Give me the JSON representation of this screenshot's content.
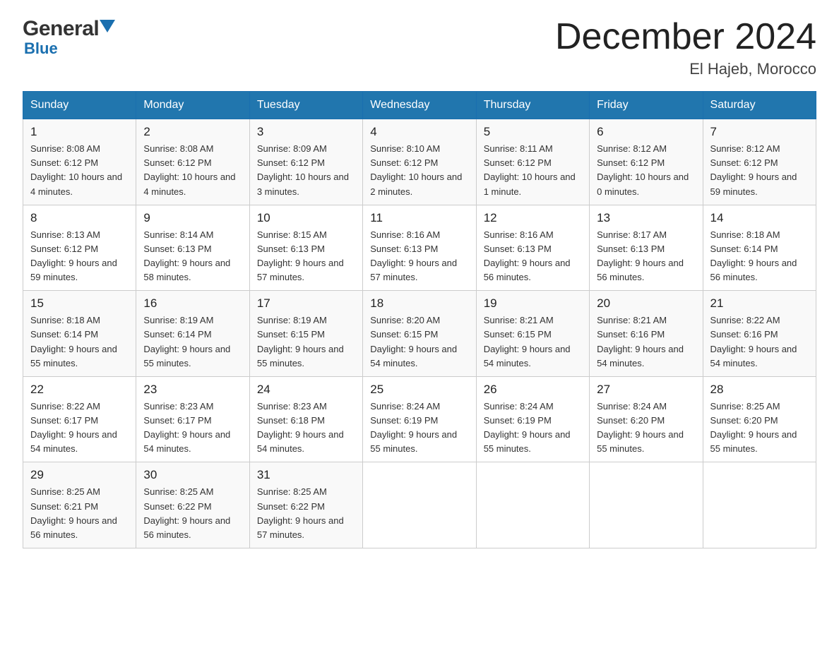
{
  "header": {
    "logo_general": "General",
    "logo_blue": "Blue",
    "main_title": "December 2024",
    "subtitle": "El Hajeb, Morocco"
  },
  "weekdays": [
    "Sunday",
    "Monday",
    "Tuesday",
    "Wednesday",
    "Thursday",
    "Friday",
    "Saturday"
  ],
  "weeks": [
    [
      {
        "day": 1,
        "sunrise": "8:08 AM",
        "sunset": "6:12 PM",
        "daylight": "10 hours and 4 minutes."
      },
      {
        "day": 2,
        "sunrise": "8:08 AM",
        "sunset": "6:12 PM",
        "daylight": "10 hours and 4 minutes."
      },
      {
        "day": 3,
        "sunrise": "8:09 AM",
        "sunset": "6:12 PM",
        "daylight": "10 hours and 3 minutes."
      },
      {
        "day": 4,
        "sunrise": "8:10 AM",
        "sunset": "6:12 PM",
        "daylight": "10 hours and 2 minutes."
      },
      {
        "day": 5,
        "sunrise": "8:11 AM",
        "sunset": "6:12 PM",
        "daylight": "10 hours and 1 minute."
      },
      {
        "day": 6,
        "sunrise": "8:12 AM",
        "sunset": "6:12 PM",
        "daylight": "10 hours and 0 minutes."
      },
      {
        "day": 7,
        "sunrise": "8:12 AM",
        "sunset": "6:12 PM",
        "daylight": "9 hours and 59 minutes."
      }
    ],
    [
      {
        "day": 8,
        "sunrise": "8:13 AM",
        "sunset": "6:12 PM",
        "daylight": "9 hours and 59 minutes."
      },
      {
        "day": 9,
        "sunrise": "8:14 AM",
        "sunset": "6:13 PM",
        "daylight": "9 hours and 58 minutes."
      },
      {
        "day": 10,
        "sunrise": "8:15 AM",
        "sunset": "6:13 PM",
        "daylight": "9 hours and 57 minutes."
      },
      {
        "day": 11,
        "sunrise": "8:16 AM",
        "sunset": "6:13 PM",
        "daylight": "9 hours and 57 minutes."
      },
      {
        "day": 12,
        "sunrise": "8:16 AM",
        "sunset": "6:13 PM",
        "daylight": "9 hours and 56 minutes."
      },
      {
        "day": 13,
        "sunrise": "8:17 AM",
        "sunset": "6:13 PM",
        "daylight": "9 hours and 56 minutes."
      },
      {
        "day": 14,
        "sunrise": "8:18 AM",
        "sunset": "6:14 PM",
        "daylight": "9 hours and 56 minutes."
      }
    ],
    [
      {
        "day": 15,
        "sunrise": "8:18 AM",
        "sunset": "6:14 PM",
        "daylight": "9 hours and 55 minutes."
      },
      {
        "day": 16,
        "sunrise": "8:19 AM",
        "sunset": "6:14 PM",
        "daylight": "9 hours and 55 minutes."
      },
      {
        "day": 17,
        "sunrise": "8:19 AM",
        "sunset": "6:15 PM",
        "daylight": "9 hours and 55 minutes."
      },
      {
        "day": 18,
        "sunrise": "8:20 AM",
        "sunset": "6:15 PM",
        "daylight": "9 hours and 54 minutes."
      },
      {
        "day": 19,
        "sunrise": "8:21 AM",
        "sunset": "6:15 PM",
        "daylight": "9 hours and 54 minutes."
      },
      {
        "day": 20,
        "sunrise": "8:21 AM",
        "sunset": "6:16 PM",
        "daylight": "9 hours and 54 minutes."
      },
      {
        "day": 21,
        "sunrise": "8:22 AM",
        "sunset": "6:16 PM",
        "daylight": "9 hours and 54 minutes."
      }
    ],
    [
      {
        "day": 22,
        "sunrise": "8:22 AM",
        "sunset": "6:17 PM",
        "daylight": "9 hours and 54 minutes."
      },
      {
        "day": 23,
        "sunrise": "8:23 AM",
        "sunset": "6:17 PM",
        "daylight": "9 hours and 54 minutes."
      },
      {
        "day": 24,
        "sunrise": "8:23 AM",
        "sunset": "6:18 PM",
        "daylight": "9 hours and 54 minutes."
      },
      {
        "day": 25,
        "sunrise": "8:24 AM",
        "sunset": "6:19 PM",
        "daylight": "9 hours and 55 minutes."
      },
      {
        "day": 26,
        "sunrise": "8:24 AM",
        "sunset": "6:19 PM",
        "daylight": "9 hours and 55 minutes."
      },
      {
        "day": 27,
        "sunrise": "8:24 AM",
        "sunset": "6:20 PM",
        "daylight": "9 hours and 55 minutes."
      },
      {
        "day": 28,
        "sunrise": "8:25 AM",
        "sunset": "6:20 PM",
        "daylight": "9 hours and 55 minutes."
      }
    ],
    [
      {
        "day": 29,
        "sunrise": "8:25 AM",
        "sunset": "6:21 PM",
        "daylight": "9 hours and 56 minutes."
      },
      {
        "day": 30,
        "sunrise": "8:25 AM",
        "sunset": "6:22 PM",
        "daylight": "9 hours and 56 minutes."
      },
      {
        "day": 31,
        "sunrise": "8:25 AM",
        "sunset": "6:22 PM",
        "daylight": "9 hours and 57 minutes."
      },
      null,
      null,
      null,
      null
    ]
  ]
}
